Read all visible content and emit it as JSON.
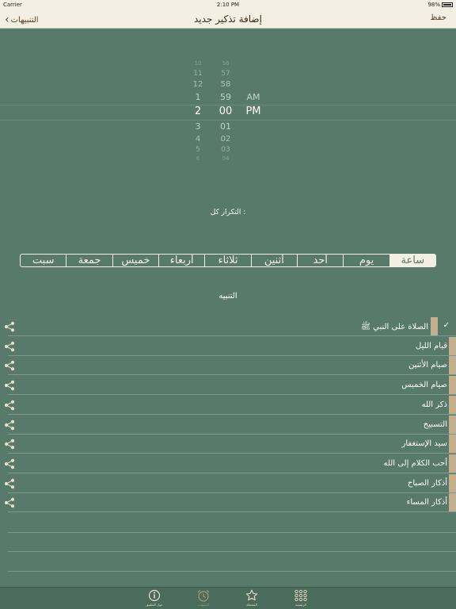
{
  "status_bar": {
    "carrier": "Carrier",
    "time": "2:10 PM",
    "battery": "98%"
  },
  "nav": {
    "back_label": "التنبيهات",
    "title": "إضافة تذكير جديد",
    "save_label": "حفظ"
  },
  "time_picker": {
    "hours": [
      "10",
      "11",
      "12",
      "1",
      "2",
      "3",
      "4",
      "5",
      "6"
    ],
    "minutes": [
      "56",
      "57",
      "58",
      "59",
      "00",
      "01",
      "02",
      "03",
      "04"
    ],
    "ampm": [
      "AM",
      "PM"
    ],
    "selected": {
      "hour": "2",
      "minute": "00",
      "ampm": "PM"
    }
  },
  "repeat": {
    "label": "التكرار كل :",
    "options": [
      "ساعة",
      "يوم",
      "أحد",
      "أثنين",
      "ثلاثاء",
      "أربعاء",
      "خميس",
      "جمعة",
      "سبت"
    ],
    "selected": "ساعة"
  },
  "alert_section": {
    "label": "التنبيه"
  },
  "alerts": [
    {
      "label": "الصلاة على النبي ﷺ",
      "checked": true
    },
    {
      "label": "قيام الليل",
      "checked": false
    },
    {
      "label": "صيام الأثنين",
      "checked": false
    },
    {
      "label": "صيام الخميس",
      "checked": false
    },
    {
      "label": "ذكر الله",
      "checked": false
    },
    {
      "label": "التسبيح",
      "checked": false
    },
    {
      "label": "سيد الإستغفار",
      "checked": false
    },
    {
      "label": "أحب الكلام إلى الله",
      "checked": false
    },
    {
      "label": "أذكار الصباح",
      "checked": false
    },
    {
      "label": "أذكار المساء",
      "checked": false
    }
  ],
  "tab_bar": {
    "items": [
      {
        "label": "حول التطبيق",
        "icon": "info-icon"
      },
      {
        "label": "التنبيهات",
        "icon": "alarm-clock-icon",
        "active": true
      },
      {
        "label": "المفضلة",
        "icon": "star-icon"
      },
      {
        "label": "الرئيسية",
        "icon": "grid-icon"
      }
    ]
  },
  "colors": {
    "background": "#577a6a",
    "bar": "#f3efe3",
    "accent_brown": "#c3ae8e",
    "tab_bar": "#4b6b5c"
  }
}
